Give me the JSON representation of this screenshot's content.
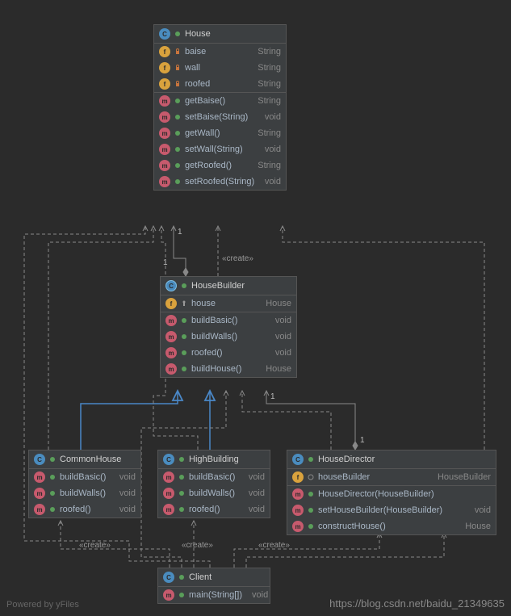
{
  "classes": {
    "house": {
      "name": "House",
      "fields": [
        {
          "name": "baise",
          "type": "String",
          "vis": "private"
        },
        {
          "name": "wall",
          "type": "String",
          "vis": "private"
        },
        {
          "name": "roofed",
          "type": "String",
          "vis": "private"
        }
      ],
      "methods": [
        {
          "name": "getBaise()",
          "type": "String",
          "vis": "public"
        },
        {
          "name": "setBaise(String)",
          "type": "void",
          "vis": "public"
        },
        {
          "name": "getWall()",
          "type": "String",
          "vis": "public"
        },
        {
          "name": "setWall(String)",
          "type": "void",
          "vis": "public"
        },
        {
          "name": "getRoofed()",
          "type": "String",
          "vis": "public"
        },
        {
          "name": "setRoofed(String)",
          "type": "void",
          "vis": "public"
        }
      ]
    },
    "builder": {
      "name": "HouseBuilder",
      "fields": [
        {
          "name": "house",
          "type": "House",
          "vis": "protected"
        }
      ],
      "methods": [
        {
          "name": "buildBasic()",
          "type": "void",
          "vis": "public"
        },
        {
          "name": "buildWalls()",
          "type": "void",
          "vis": "public"
        },
        {
          "name": "roofed()",
          "type": "void",
          "vis": "public"
        },
        {
          "name": "buildHouse()",
          "type": "House",
          "vis": "public"
        }
      ]
    },
    "common": {
      "name": "CommonHouse",
      "methods": [
        {
          "name": "buildBasic()",
          "type": "void",
          "vis": "public"
        },
        {
          "name": "buildWalls()",
          "type": "void",
          "vis": "public"
        },
        {
          "name": "roofed()",
          "type": "void",
          "vis": "public"
        }
      ]
    },
    "high": {
      "name": "HighBuilding",
      "methods": [
        {
          "name": "buildBasic()",
          "type": "void",
          "vis": "public"
        },
        {
          "name": "buildWalls()",
          "type": "void",
          "vis": "public"
        },
        {
          "name": "roofed()",
          "type": "void",
          "vis": "public"
        }
      ]
    },
    "director": {
      "name": "HouseDirector",
      "fields": [
        {
          "name": "houseBuilder",
          "type": "HouseBuilder",
          "vis": "package"
        }
      ],
      "methods": [
        {
          "name": "HouseDirector(HouseBuilder)",
          "type": "",
          "vis": "public"
        },
        {
          "name": "setHouseBuilder(HouseBuilder)",
          "type": "void",
          "vis": "public"
        },
        {
          "name": "constructHouse()",
          "type": "House",
          "vis": "public"
        }
      ]
    },
    "client": {
      "name": "Client",
      "methods": [
        {
          "name": "main(String[])",
          "type": "void",
          "vis": "public"
        }
      ]
    }
  },
  "stereotypes": {
    "create1": "«create»",
    "create2": "«create»",
    "create3": "«create»",
    "create4": "«create»"
  },
  "multiplicities": {
    "m1": "1",
    "m2": "1",
    "m3": "1",
    "m4": "1"
  },
  "footer": {
    "left": "Powered by yFiles",
    "right": "https://blog.csdn.net/baidu_21349635"
  }
}
